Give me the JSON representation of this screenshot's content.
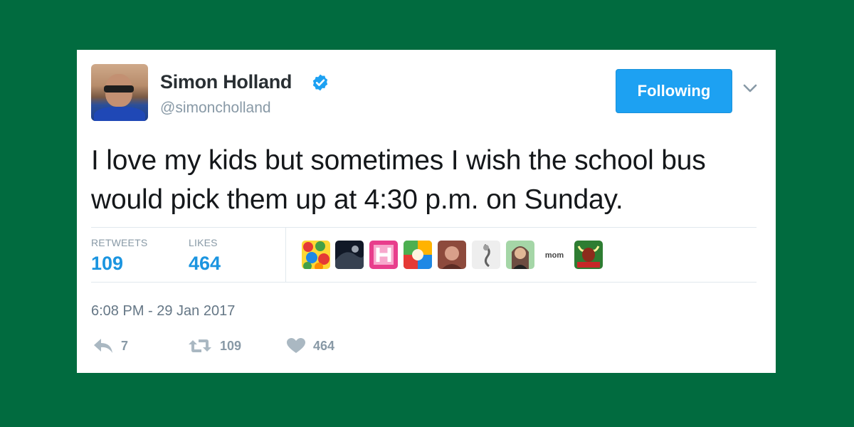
{
  "tweet": {
    "author": {
      "name": "Simon Holland",
      "handle": "@simoncholland",
      "verified": true
    },
    "follow_button_label": "Following",
    "text": "I love my kids but sometimes I wish the school bus would pick them up at 4:30 p.m. on Sunday.",
    "stats": {
      "retweets_label": "RETWEETS",
      "retweets_value": "109",
      "likes_label": "LIKES",
      "likes_value": "464"
    },
    "liker_avatars": [
      {
        "icon": "candy-avatar",
        "colors": [
          "#e53935",
          "#fdd835",
          "#43a047"
        ]
      },
      {
        "icon": "dark-photo-avatar",
        "colors": [
          "#111827",
          "#4b5563",
          "#9ca3af"
        ]
      },
      {
        "icon": "h-logo-avatar",
        "colors": [
          "#e83e8c",
          "#ffffff"
        ]
      },
      {
        "icon": "colorful-photo-avatar",
        "colors": [
          "#4caf50",
          "#ffb300",
          "#795548"
        ]
      },
      {
        "icon": "woman-photo-avatar",
        "colors": [
          "#8d4a3c",
          "#d9a08a"
        ]
      },
      {
        "icon": "sketch-avatar",
        "colors": [
          "#e5e5e5",
          "#9e9e9e"
        ]
      },
      {
        "icon": "woman-photo-avatar-2",
        "colors": [
          "#6d4c41",
          "#e0b896"
        ]
      },
      {
        "icon": "mom-logo-avatar",
        "text": "mom"
      },
      {
        "icon": "bull-logo-avatar",
        "colors": [
          "#2e7d32",
          "#8d2c1c",
          "#fff59d"
        ]
      }
    ],
    "timestamp": "6:08 PM - 29 Jan 2017",
    "actions": {
      "reply_count": "7",
      "retweet_count": "109",
      "like_count": "464"
    },
    "colors": {
      "background": "#016b3f",
      "accent": "#1da1f2",
      "count_blue": "#1b95e0",
      "muted": "#8899a6"
    }
  }
}
